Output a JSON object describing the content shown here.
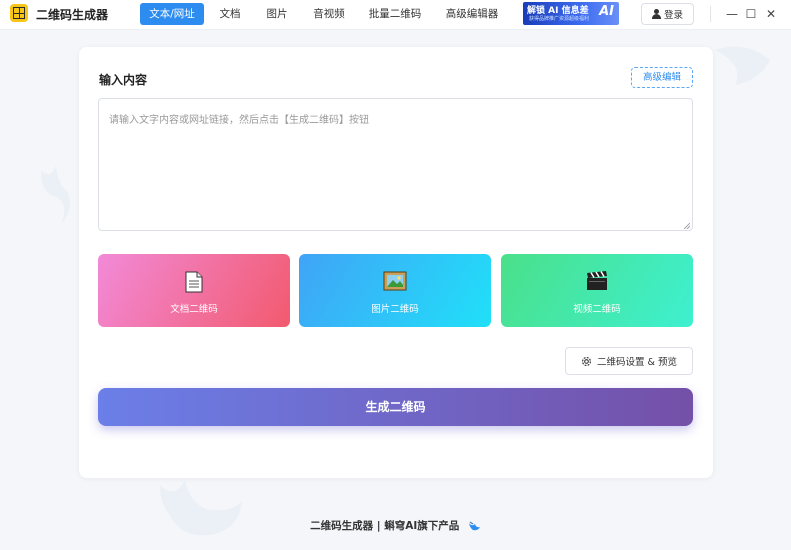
{
  "app": {
    "title": "二维码生成器",
    "logo_icon": "qr-logo-icon"
  },
  "nav": {
    "tabs": [
      {
        "label": "文本/网址",
        "active": true
      },
      {
        "label": "文档",
        "active": false
      },
      {
        "label": "图片",
        "active": false
      },
      {
        "label": "音视频",
        "active": false
      },
      {
        "label": "批量二维码",
        "active": false
      },
      {
        "label": "高级编辑器",
        "active": false
      }
    ]
  },
  "promo": {
    "line1": "解锁 AI 信息差",
    "line2": "获得品牌推广资源超级福利",
    "badge": "AI"
  },
  "header": {
    "login_label": "登录",
    "minimize": "—",
    "maximize": "☐",
    "close": "✕"
  },
  "input_section": {
    "title": "输入内容",
    "advanced_edit_label": "高级编辑",
    "placeholder": "请输入文字内容或网址链接，然后点击【生成二维码】按钮",
    "value": ""
  },
  "type_tiles": [
    {
      "label": "文档二维码",
      "icon": "document-icon"
    },
    {
      "label": "图片二维码",
      "icon": "picture-icon"
    },
    {
      "label": "视频二维码",
      "icon": "clapperboard-icon"
    }
  ],
  "settings_button_label": "二维码设置 & 预览",
  "generate_button_label": "生成二维码",
  "footer": {
    "text": "二维码生成器 | 蝌穹AI旗下产品"
  },
  "colors": {
    "primary": "#2d8cf0",
    "generate_start": "#6b7fe8",
    "generate_end": "#7450a8",
    "doc_tile": "#f25a6e",
    "img_tile": "#40a4f7",
    "vid_tile": "#4ae08a"
  }
}
